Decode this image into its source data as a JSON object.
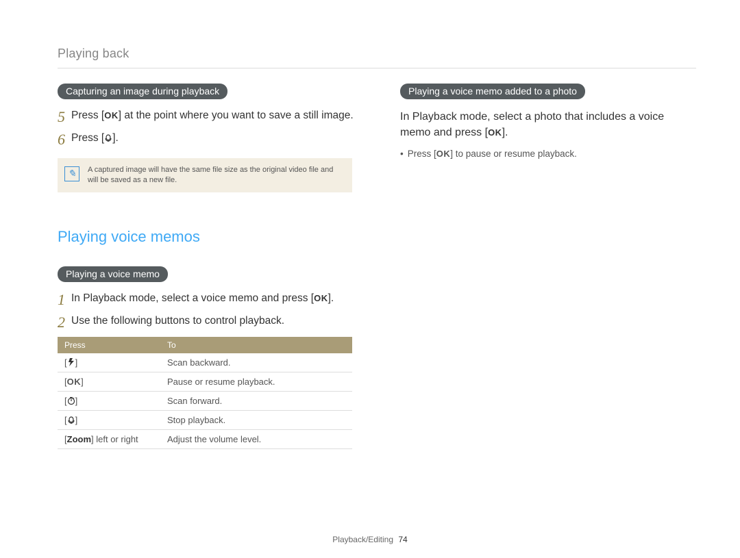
{
  "breadcrumb": "Playing back",
  "left": {
    "pill1": "Capturing an image during playback",
    "step5": {
      "num": "5",
      "pre": "Press [",
      "ok": "OK",
      "post": "] at the point where you want to save a still image."
    },
    "step6": {
      "num": "6",
      "pre": "Press [",
      "icon": "macro-icon",
      "post": "]."
    },
    "note": "A captured image will have the same file size as the original video file and will be saved as a new file.",
    "heading": "Playing voice memos",
    "pill2": "Playing a voice memo",
    "step1": {
      "num": "1",
      "pre": "In Playback mode, select a voice memo and press [",
      "ok": "OK",
      "post": "]."
    },
    "step2": {
      "num": "2",
      "text": "Use the following buttons to control playback."
    },
    "table": {
      "head": {
        "press": "Press",
        "to": "To"
      },
      "rows": [
        {
          "press_icon": "flash-icon",
          "to": "Scan backward."
        },
        {
          "press_ok": "OK",
          "to": "Pause or resume playback."
        },
        {
          "press_icon": "timer-icon",
          "to": "Scan forward."
        },
        {
          "press_icon": "macro-icon",
          "to": "Stop playback."
        },
        {
          "press_text_bold": "Zoom",
          "press_text_rest": " left or right",
          "to": "Adjust the volume level."
        }
      ]
    }
  },
  "right": {
    "pill": "Playing a voice memo added to a photo",
    "body": {
      "pre": "In Playback mode, select a photo that includes a voice memo and press [",
      "ok": "OK",
      "post": "]."
    },
    "bullet": {
      "pre": "Press [",
      "ok": "OK",
      "post": "] to pause or resume playback."
    }
  },
  "footer": {
    "section": "Playback/Editing",
    "page": "74"
  }
}
